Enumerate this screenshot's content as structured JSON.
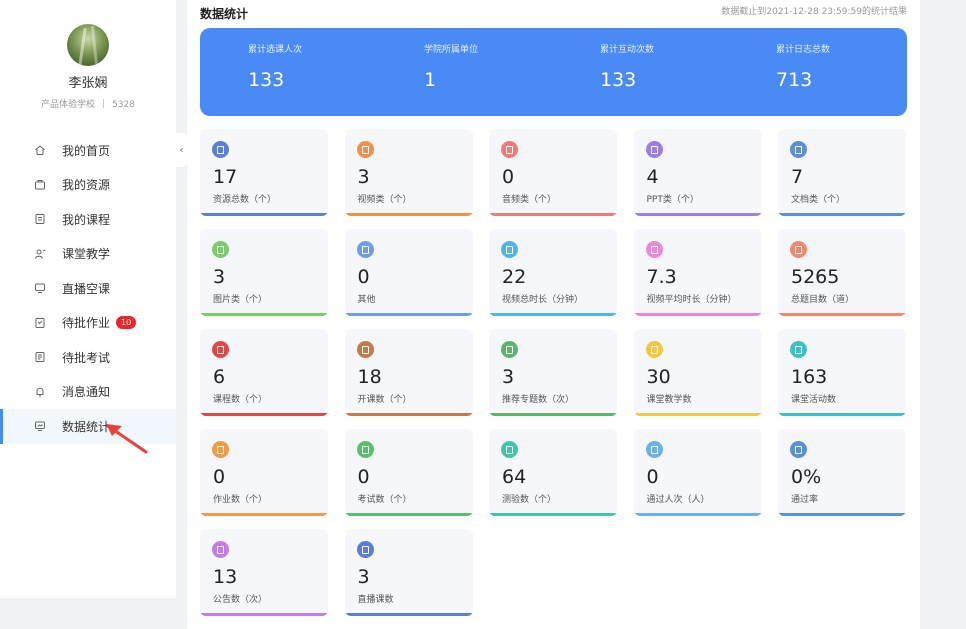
{
  "profile": {
    "name": "李张娴",
    "school": "产品体验学校",
    "id": "5328"
  },
  "menu": [
    {
      "label": "我的首页",
      "icon": "home-icon",
      "active": false
    },
    {
      "label": "我的资源",
      "icon": "resource-icon",
      "active": false
    },
    {
      "label": "我的课程",
      "icon": "course-icon",
      "active": false
    },
    {
      "label": "课堂教学",
      "icon": "teacher-icon",
      "active": false
    },
    {
      "label": "直播空课",
      "icon": "monitor-icon",
      "active": false
    },
    {
      "label": "待批作业",
      "icon": "homework-icon",
      "active": false,
      "badge": "10"
    },
    {
      "label": "待批考试",
      "icon": "exam-icon",
      "active": false
    },
    {
      "label": "消息通知",
      "icon": "bell-icon",
      "active": false
    },
    {
      "label": "数据统计",
      "icon": "chart-icon",
      "active": true
    }
  ],
  "header": {
    "title": "数据统计",
    "date_note": "数据截止到2021-12-28 23:59:59的统计结果"
  },
  "banner": [
    {
      "label": "累计选课人次",
      "value": "133"
    },
    {
      "label": "学院所属单位",
      "value": "1"
    },
    {
      "label": "累计互动次数",
      "value": "133"
    },
    {
      "label": "累计日志总数",
      "value": "713"
    }
  ],
  "cards": [
    {
      "value": "17",
      "label": "资源总数（个）",
      "color": "#5b7fd6",
      "icon": "resource-icon"
    },
    {
      "value": "3",
      "label": "视频类（个）",
      "color": "#f0904a",
      "icon": "video-icon"
    },
    {
      "value": "0",
      "label": "音频类（个）",
      "color": "#f07b7b",
      "icon": "music-icon"
    },
    {
      "value": "4",
      "label": "PPT类（个）",
      "color": "#9b7ee6",
      "icon": "ppt-icon"
    },
    {
      "value": "7",
      "label": "文档类（个）",
      "color": "#5b8fd6",
      "icon": "document-icon"
    },
    {
      "value": "3",
      "label": "图片类（个）",
      "color": "#7ccc6e",
      "icon": "image-icon"
    },
    {
      "value": "0",
      "label": "其他",
      "color": "#6e9fe6",
      "icon": "other-icon"
    },
    {
      "value": "22",
      "label": "视频总时长（分钟）",
      "color": "#4fb6e6",
      "icon": "clock-icon"
    },
    {
      "value": "7.3",
      "label": "视频平均时长（分钟）",
      "color": "#e88ad6",
      "icon": "clock-icon"
    },
    {
      "value": "5265",
      "label": "总题目数（道）",
      "color": "#f08a6e",
      "icon": "question-icon"
    },
    {
      "value": "6",
      "label": "课程数（个）",
      "color": "#e04848",
      "icon": "course-icon"
    },
    {
      "value": "18",
      "label": "开课数（个）",
      "color": "#c67a4a",
      "icon": "open-course-icon"
    },
    {
      "value": "3",
      "label": "推荐专题数（次）",
      "color": "#5bb56e",
      "icon": "topic-icon"
    },
    {
      "value": "30",
      "label": "课堂教学数",
      "color": "#f0c84a",
      "icon": "teach-icon"
    },
    {
      "value": "163",
      "label": "课堂活动数",
      "color": "#3fbfc6",
      "icon": "activity-icon"
    },
    {
      "value": "0",
      "label": "作业数（个）",
      "color": "#f09a4a",
      "icon": "homework-icon"
    },
    {
      "value": "0",
      "label": "考试数（个）",
      "color": "#5bc06e",
      "icon": "exam-icon"
    },
    {
      "value": "64",
      "label": "测验数（个）",
      "color": "#3fc6a8",
      "icon": "quiz-icon"
    },
    {
      "value": "0",
      "label": "通过人次（人）",
      "color": "#6eb0ee",
      "icon": "pass-icon"
    },
    {
      "value": "0%",
      "label": "通过率",
      "color": "#5b8fd6",
      "icon": "rate-icon"
    },
    {
      "value": "13",
      "label": "公告数（次）",
      "color": "#c27ee6",
      "icon": "announce-icon"
    },
    {
      "value": "3",
      "label": "直播课数",
      "color": "#5b7fd6",
      "icon": "live-icon"
    }
  ]
}
